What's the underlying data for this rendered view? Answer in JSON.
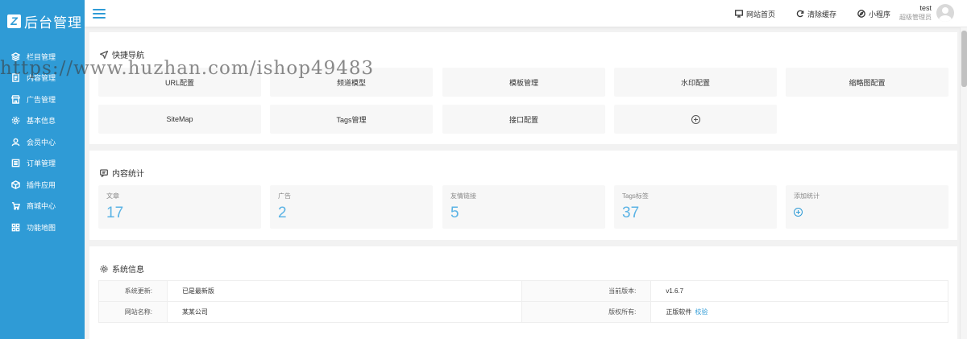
{
  "logo": {
    "mark": "Z",
    "title": "后台管理"
  },
  "sidebar": {
    "items": [
      {
        "icon": "layers-icon",
        "label": "栏目管理"
      },
      {
        "icon": "document-icon",
        "label": "内容管理"
      },
      {
        "icon": "store-icon",
        "label": "广告管理"
      },
      {
        "icon": "gear-icon",
        "label": "基本信息"
      },
      {
        "icon": "user-icon",
        "label": "会员中心"
      },
      {
        "icon": "list-icon",
        "label": "订单管理"
      },
      {
        "icon": "cube-icon",
        "label": "插件应用"
      },
      {
        "icon": "cart-icon",
        "label": "商城中心"
      },
      {
        "icon": "grid-icon",
        "label": "功能地图"
      }
    ]
  },
  "header": {
    "links": [
      {
        "icon": "monitor-icon",
        "label": "网站首页"
      },
      {
        "icon": "refresh-icon",
        "label": "清除缓存"
      },
      {
        "icon": "compass-icon",
        "label": "小程序"
      }
    ],
    "user": {
      "name": "test",
      "role": "超级管理员"
    }
  },
  "quick_nav": {
    "title": "快捷导航",
    "items": [
      "URL配置",
      "频道模型",
      "模板管理",
      "水印配置",
      "缩略图配置",
      "SiteMap",
      "Tags管理",
      "接口配置"
    ]
  },
  "stats": {
    "title": "内容统计",
    "items": [
      {
        "label": "文章",
        "value": "17"
      },
      {
        "label": "广告",
        "value": "2"
      },
      {
        "label": "友情链接",
        "value": "5"
      },
      {
        "label": "Tags标签",
        "value": "37"
      }
    ],
    "add_label": "添加统计"
  },
  "sysinfo": {
    "title": "系统信息",
    "rows": [
      {
        "k1": "系统更新:",
        "v1": "已是最新版",
        "k2": "当前版本:",
        "v2": "v1.6.7"
      },
      {
        "k1": "网站名称:",
        "v1": "某某公司",
        "k2": "版权所有:",
        "v2": "正版软件",
        "v2_link": "校验"
      }
    ]
  },
  "watermark": "https://www.huzhan.com/ishop49483",
  "colors": {
    "sidebar": "#2f9bd6",
    "accent": "#5bb3e5"
  }
}
